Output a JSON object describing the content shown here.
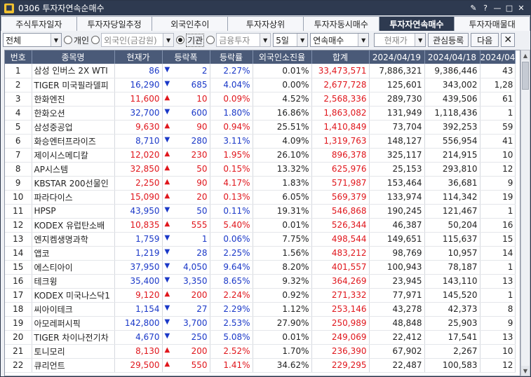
{
  "window": {
    "title": "0306 투자자연속순매수",
    "logo": "yellow-square-logo"
  },
  "title_controls": [
    "pin-icon",
    "help-icon",
    "minimize-icon",
    "maximize-icon",
    "close-icon"
  ],
  "tabs": [
    "주식투자일자",
    "투자자당일추정",
    "외국인추이",
    "투자자상위",
    "투자자동시매수",
    "투자자연속매수",
    "투자자매물대"
  ],
  "active_tab": 5,
  "toolbar": {
    "market": "전체",
    "radio_individual": "개인",
    "radio_foreign": "외국인(금감원)",
    "radio_institution": "기관",
    "radio_financial": "금융투자",
    "period": "5일",
    "mode": "연속매수",
    "price_btn": "현재가",
    "watch_btn": "관심등록",
    "next_btn": "다음",
    "close_btn": "✕"
  },
  "columns": [
    "번호",
    "종목명",
    "현재가",
    "등락폭",
    "등락률",
    "외국인소진율",
    "합계",
    "2024/04/19",
    "2024/04/18",
    "2024/04"
  ],
  "rows": [
    {
      "no": "1",
      "name": "삼성 인버스 2X WTI",
      "price": "86",
      "dir": "down",
      "chg": "2",
      "rate": "2.27%",
      "foreign": "0.01%",
      "sum": "33,473,571",
      "d1": "7,886,321",
      "d2": "9,386,446",
      "d3": "43"
    },
    {
      "no": "2",
      "name": "TIGER 미국필라델피",
      "price": "16,290",
      "dir": "down",
      "chg": "685",
      "rate": "4.04%",
      "foreign": "0.00%",
      "sum": "2,677,728",
      "d1": "125,601",
      "d2": "343,002",
      "d3": "1,28"
    },
    {
      "no": "3",
      "name": "한화엔진",
      "price": "11,600",
      "dir": "up",
      "chg": "10",
      "rate": "0.09%",
      "foreign": "4.52%",
      "sum": "2,568,336",
      "d1": "289,730",
      "d2": "439,506",
      "d3": "61"
    },
    {
      "no": "4",
      "name": "한화오션",
      "price": "32,700",
      "dir": "down",
      "chg": "600",
      "rate": "1.80%",
      "foreign": "16.86%",
      "sum": "1,863,082",
      "d1": "131,949",
      "d2": "1,118,436",
      "d3": "1"
    },
    {
      "no": "5",
      "name": "삼성중공업",
      "price": "9,630",
      "dir": "up",
      "chg": "90",
      "rate": "0.94%",
      "foreign": "25.51%",
      "sum": "1,410,849",
      "d1": "73,704",
      "d2": "392,253",
      "d3": "59"
    },
    {
      "no": "6",
      "name": "화승엔터프라이즈",
      "price": "8,710",
      "dir": "down",
      "chg": "280",
      "rate": "3.11%",
      "foreign": "4.09%",
      "sum": "1,319,763",
      "d1": "148,127",
      "d2": "556,954",
      "d3": "41"
    },
    {
      "no": "7",
      "name": "제이시스메디칼",
      "price": "12,020",
      "dir": "up",
      "chg": "230",
      "rate": "1.95%",
      "foreign": "26.10%",
      "sum": "896,378",
      "d1": "325,117",
      "d2": "214,915",
      "d3": "10"
    },
    {
      "no": "8",
      "name": "AP시스템",
      "price": "32,850",
      "dir": "up",
      "chg": "50",
      "rate": "0.15%",
      "foreign": "13.32%",
      "sum": "625,976",
      "d1": "25,153",
      "d2": "293,810",
      "d3": "12"
    },
    {
      "no": "9",
      "name": "KBSTAR 200선물인",
      "price": "2,250",
      "dir": "up",
      "chg": "90",
      "rate": "4.17%",
      "foreign": "1.83%",
      "sum": "571,987",
      "d1": "153,464",
      "d2": "36,681",
      "d3": "9"
    },
    {
      "no": "10",
      "name": "파라다이스",
      "price": "15,090",
      "dir": "up",
      "chg": "20",
      "rate": "0.13%",
      "foreign": "6.05%",
      "sum": "569,379",
      "d1": "133,974",
      "d2": "114,342",
      "d3": "19"
    },
    {
      "no": "11",
      "name": "HPSP",
      "price": "43,950",
      "dir": "down",
      "chg": "50",
      "rate": "0.11%",
      "foreign": "19.31%",
      "sum": "546,868",
      "d1": "190,245",
      "d2": "121,467",
      "d3": "1"
    },
    {
      "no": "12",
      "name": "KODEX 유럽탄소배",
      "price": "10,835",
      "dir": "up",
      "chg": "555",
      "rate": "5.40%",
      "foreign": "0.01%",
      "sum": "526,344",
      "d1": "46,387",
      "d2": "50,204",
      "d3": "16"
    },
    {
      "no": "13",
      "name": "엔지켐생명과학",
      "price": "1,759",
      "dir": "down",
      "chg": "1",
      "rate": "0.06%",
      "foreign": "7.75%",
      "sum": "498,544",
      "d1": "149,651",
      "d2": "115,637",
      "d3": "15"
    },
    {
      "no": "14",
      "name": "앱코",
      "price": "1,219",
      "dir": "down",
      "chg": "28",
      "rate": "2.25%",
      "foreign": "1.56%",
      "sum": "483,212",
      "d1": "98,769",
      "d2": "10,957",
      "d3": "14"
    },
    {
      "no": "15",
      "name": "에스티아이",
      "price": "37,950",
      "dir": "down",
      "chg": "4,050",
      "rate": "9.64%",
      "foreign": "8.20%",
      "sum": "401,557",
      "d1": "100,943",
      "d2": "78,187",
      "d3": "1"
    },
    {
      "no": "16",
      "name": "테크윙",
      "price": "35,400",
      "dir": "down",
      "chg": "3,350",
      "rate": "8.65%",
      "foreign": "9.32%",
      "sum": "364,269",
      "d1": "23,945",
      "d2": "143,110",
      "d3": "13"
    },
    {
      "no": "17",
      "name": "KODEX 미국나스닥1",
      "price": "9,120",
      "dir": "up",
      "chg": "200",
      "rate": "2.24%",
      "foreign": "0.92%",
      "sum": "271,332",
      "d1": "77,971",
      "d2": "145,520",
      "d3": "1"
    },
    {
      "no": "18",
      "name": "씨아이테크",
      "price": "1,154",
      "dir": "down",
      "chg": "27",
      "rate": "2.29%",
      "foreign": "1.12%",
      "sum": "253,146",
      "d1": "43,278",
      "d2": "42,373",
      "d3": "8"
    },
    {
      "no": "19",
      "name": "아모레퍼시픽",
      "price": "142,800",
      "dir": "down",
      "chg": "3,700",
      "rate": "2.53%",
      "foreign": "27.90%",
      "sum": "250,989",
      "d1": "48,848",
      "d2": "25,903",
      "d3": "9"
    },
    {
      "no": "20",
      "name": "TIGER 차이나전기차",
      "price": "4,670",
      "dir": "down",
      "chg": "250",
      "rate": "5.08%",
      "foreign": "0.01%",
      "sum": "249,069",
      "d1": "22,412",
      "d2": "17,541",
      "d3": "13"
    },
    {
      "no": "21",
      "name": "토니모리",
      "price": "8,130",
      "dir": "up",
      "chg": "200",
      "rate": "2.52%",
      "foreign": "1.70%",
      "sum": "236,390",
      "d1": "67,902",
      "d2": "2,267",
      "d3": "10"
    },
    {
      "no": "22",
      "name": "큐리언트",
      "price": "29,500",
      "dir": "up",
      "chg": "550",
      "rate": "1.41%",
      "foreign": "34.62%",
      "sum": "229,295",
      "d1": "22,487",
      "d2": "100,583",
      "d3": "12"
    }
  ],
  "colors": {
    "up": "#e0161c",
    "down": "#1a38c8",
    "header": "#4a5a78",
    "titlebar": "#2e3a50"
  }
}
